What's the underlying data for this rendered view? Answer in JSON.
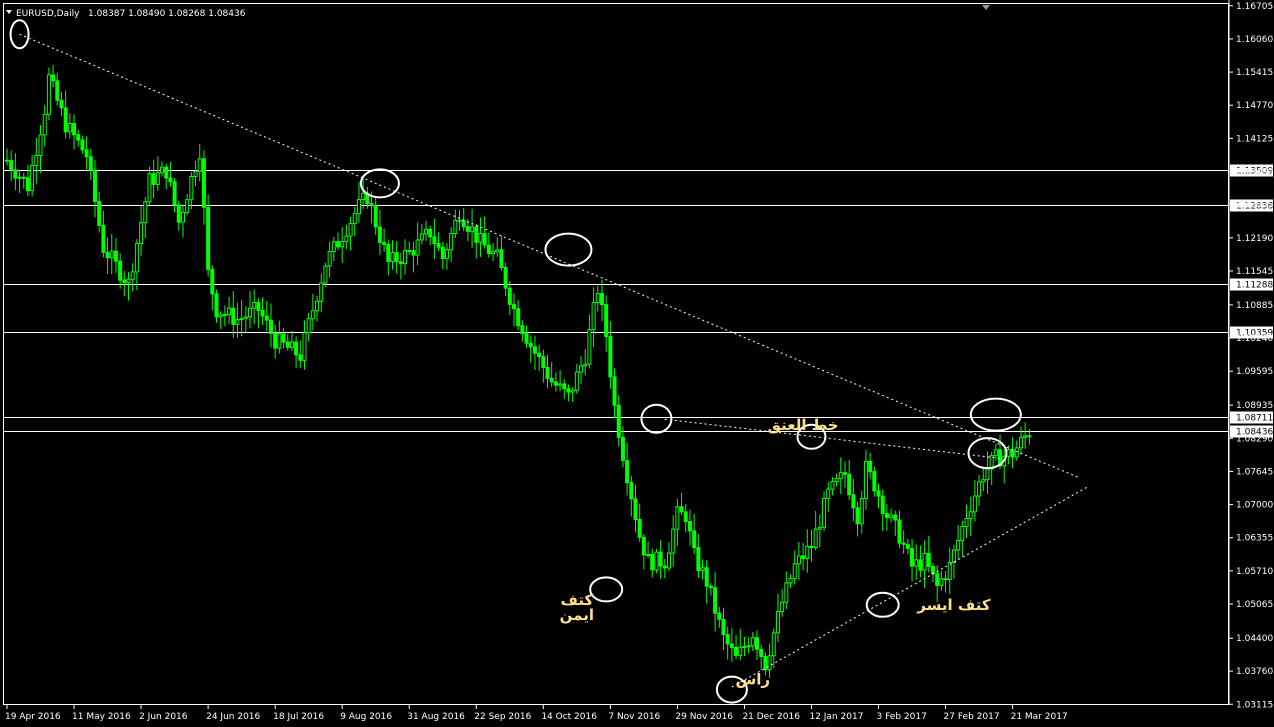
{
  "header": {
    "symbol_tf": "EURUSD,Daily",
    "ohlc": "1.08387 1.08490 1.08268 1.08436"
  },
  "chart_data": {
    "type": "candlestick",
    "symbol": "EURUSD",
    "timeframe": "Daily",
    "bar_color": "#00ff00",
    "background": "#000000",
    "ylim": [
      1.0312,
      1.1672
    ],
    "y_ticks": [
      "1.16705",
      "1.16060",
      "1.15415",
      "1.14770",
      "1.14125",
      "1.13480",
      "1.12835",
      "1.12190",
      "1.11545",
      "1.10885",
      "1.10240",
      "1.09595",
      "1.08935",
      "1.08290",
      "1.07645",
      "1.07000",
      "1.06355",
      "1.05710",
      "1.05065",
      "1.04400",
      "1.03760",
      "1.03115"
    ],
    "x_ticks": [
      {
        "label": "19 Apr 2016",
        "idx": 0
      },
      {
        "label": "11 May 2016",
        "idx": 16
      },
      {
        "label": "2 Jun 2016",
        "idx": 32
      },
      {
        "label": "24 Jun 2016",
        "idx": 48
      },
      {
        "label": "18 Jul 2016",
        "idx": 64
      },
      {
        "label": "9 Aug 2016",
        "idx": 80
      },
      {
        "label": "31 Aug 2016",
        "idx": 96
      },
      {
        "label": "22 Sep 2016",
        "idx": 112
      },
      {
        "label": "14 Oct 2016",
        "idx": 128
      },
      {
        "label": "7 Nov 2016",
        "idx": 144
      },
      {
        "label": "29 Nov 2016",
        "idx": 160
      },
      {
        "label": "21 Dec 2016",
        "idx": 176
      },
      {
        "label": "12 Jan 2017",
        "idx": 192
      },
      {
        "label": "3 Feb 2017",
        "idx": 208
      },
      {
        "label": "27 Feb 2017",
        "idx": 224
      },
      {
        "label": "21 Mar 2017",
        "idx": 240
      }
    ],
    "n_bars": 245,
    "price_path": [
      [
        0,
        1.137
      ],
      [
        5,
        1.132
      ],
      [
        9,
        1.147
      ],
      [
        10,
        1.153
      ],
      [
        14,
        1.144
      ],
      [
        19,
        1.138
      ],
      [
        23,
        1.12
      ],
      [
        29,
        1.113
      ],
      [
        34,
        1.133
      ],
      [
        38,
        1.135
      ],
      [
        41,
        1.125
      ],
      [
        46,
        1.139
      ],
      [
        48,
        1.115
      ],
      [
        50,
        1.108
      ],
      [
        55,
        1.106
      ],
      [
        60,
        1.108
      ],
      [
        64,
        1.102
      ],
      [
        70,
        1.099
      ],
      [
        76,
        1.117
      ],
      [
        84,
        1.128
      ],
      [
        86,
        1.13
      ],
      [
        91,
        1.117
      ],
      [
        96,
        1.119
      ],
      [
        101,
        1.123
      ],
      [
        104,
        1.118
      ],
      [
        108,
        1.127
      ],
      [
        113,
        1.121
      ],
      [
        117,
        1.118
      ],
      [
        121,
        1.108
      ],
      [
        125,
        1.101
      ],
      [
        130,
        1.094
      ],
      [
        134,
        1.091
      ],
      [
        138,
        1.099
      ],
      [
        141,
        1.112
      ],
      [
        143,
        1.103
      ],
      [
        145,
        1.089
      ],
      [
        147,
        1.08
      ],
      [
        151,
        1.064
      ],
      [
        153,
        1.059
      ],
      [
        157,
        1.059
      ],
      [
        160,
        1.068
      ],
      [
        162,
        1.068
      ],
      [
        164,
        1.06
      ],
      [
        167,
        1.055
      ],
      [
        171,
        1.044
      ],
      [
        174,
        1.04
      ],
      [
        178,
        1.045
      ],
      [
        181,
        1.039
      ],
      [
        185,
        1.051
      ],
      [
        188,
        1.058
      ],
      [
        192,
        1.062
      ],
      [
        196,
        1.072
      ],
      [
        200,
        1.076
      ],
      [
        203,
        1.068
      ],
      [
        205,
        1.077
      ],
      [
        207,
        1.074
      ],
      [
        210,
        1.068
      ],
      [
        213,
        1.064
      ],
      [
        216,
        1.058
      ],
      [
        219,
        1.059
      ],
      [
        222,
        1.054
      ],
      [
        225,
        1.058
      ],
      [
        229,
        1.068
      ],
      [
        233,
        1.076
      ],
      [
        236,
        1.079
      ],
      [
        240,
        1.08
      ],
      [
        244,
        1.0843
      ]
    ],
    "horizontal_levels": [
      {
        "value": 1.13509,
        "label": "1.13509"
      },
      {
        "value": 1.12838,
        "label": "1.12838"
      },
      {
        "value": 1.11288,
        "label": "1.11288"
      },
      {
        "value": 1.10359,
        "label": "1.10359"
      },
      {
        "value": 1.08711,
        "label": "1.08711"
      },
      {
        "value": 1.08436,
        "label": "1.08436"
      }
    ],
    "trendlines": [
      {
        "name": "descending-trendline",
        "from": [
          3,
          1.1615
        ],
        "to": [
          256,
          1.0752
        ]
      },
      {
        "name": "ascending-trendline",
        "from": [
          173,
          1.0345
        ],
        "to": [
          258,
          1.0735
        ]
      },
      {
        "name": "neckline",
        "from": [
          157,
          1.0866
        ],
        "to": [
          237,
          1.079
        ]
      }
    ],
    "circles": [
      {
        "idx": 3,
        "value": 1.1615
      },
      {
        "idx": 89,
        "value": 1.1325
      },
      {
        "idx": 134,
        "value": 1.1196
      },
      {
        "idx": 155,
        "value": 1.0867
      },
      {
        "idx": 143,
        "value": 1.0535
      },
      {
        "idx": 173,
        "value": 1.034
      },
      {
        "idx": 192,
        "value": 1.0832
      },
      {
        "idx": 209,
        "value": 1.0505
      },
      {
        "idx": 236,
        "value": 1.0875
      },
      {
        "idx": 234,
        "value": 1.08
      }
    ],
    "annotations": [
      {
        "text": "كتف",
        "idx": 136,
        "value": 1.0505
      },
      {
        "text": "ايمن",
        "idx": 136,
        "value": 1.0475
      },
      {
        "text": "خط العنق",
        "idx": 190,
        "value": 1.0845
      },
      {
        "text": "راس",
        "idx": 178,
        "value": 1.035
      },
      {
        "text": "كتف ايسر",
        "idx": 226,
        "value": 1.0495
      }
    ]
  }
}
